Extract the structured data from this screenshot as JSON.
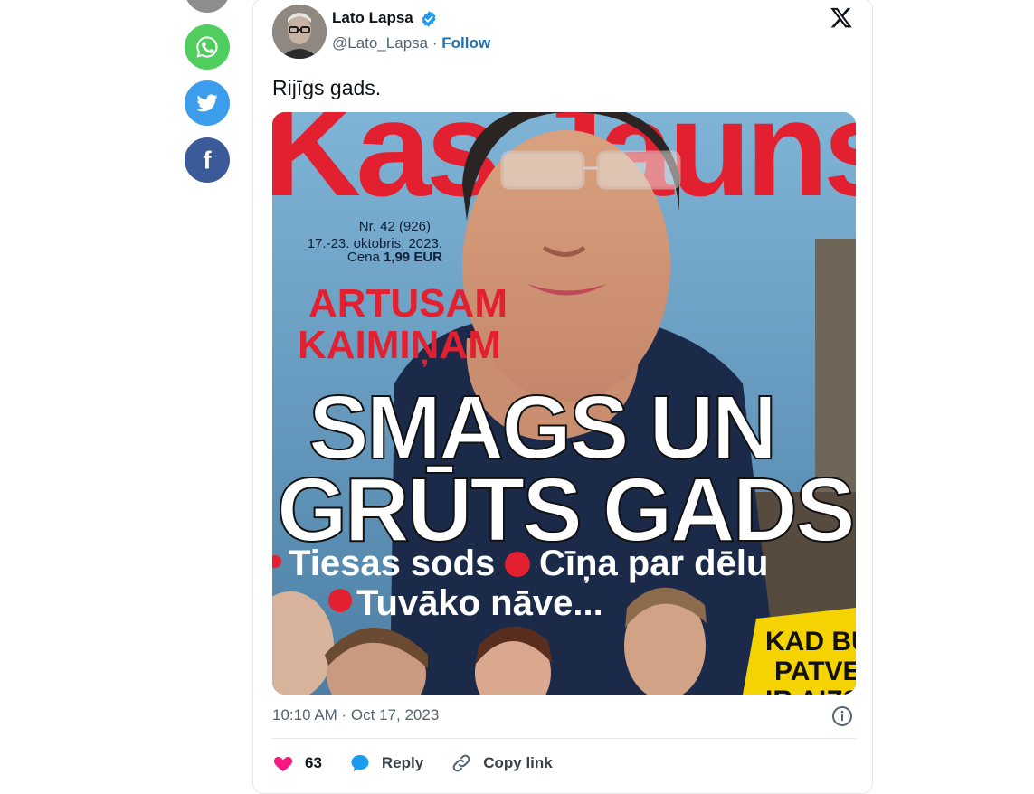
{
  "share": {
    "icons": [
      "share-icon",
      "whatsapp-icon",
      "twitter-icon",
      "facebook-icon"
    ],
    "colors": {
      "gray": "#8d8d8d",
      "whatsapp": "#4fce5d",
      "twitter": "#3d9ded",
      "facebook": "#3b5a9a"
    }
  },
  "tweet": {
    "author_name": "Lato Lapsa",
    "handle": "@Lato_Lapsa",
    "separator": "·",
    "follow_label": "Follow",
    "text": "Rijīgs gads.",
    "timestamp": "10:10 AM · Oct 17, 2023",
    "likes": "63",
    "reply_label": "Reply",
    "copy_link_label": "Copy link"
  },
  "magazine": {
    "masthead": "Kas Jauns",
    "issue_line1": "Nr. 42 (926)",
    "issue_line2": "17.-23. oktobris, 2023.",
    "price_prefix": "Cena",
    "price_value": "1,99 EUR",
    "kicker_line1": "ARTUSAM",
    "kicker_line2": "KAIMIŅAM",
    "headline_line1": "SMAGS UN",
    "headline_line2": "GRŪTS GADS",
    "bullet1": "Tiesas sods",
    "bullet2": "Cīņa par dēlu",
    "bullet3": "Tuvāko nāve...",
    "corner_line1": "KAD BŪ",
    "corner_line2": "PATVE",
    "corner_line3": "IR AIZS"
  },
  "colors": {
    "accent_blue": "#1d9bf0",
    "follow_blue": "#1d74b8",
    "like_pink": "#f91880",
    "magazine_red": "#e3202f",
    "magazine_yellow": "#f5d300"
  }
}
